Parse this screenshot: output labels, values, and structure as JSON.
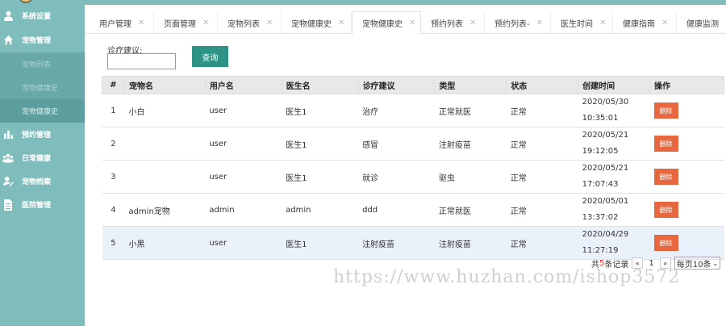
{
  "colors": {
    "sidebar": "#7fbcbc",
    "primary_button": "#2e9384",
    "delete_button": "#e7673e"
  },
  "sidebar": {
    "items": [
      {
        "label": "系统设置",
        "icon": "user-icon"
      },
      {
        "label": "宠物管理",
        "icon": "home-icon"
      },
      {
        "label": "预约管理",
        "icon": "bar-chart-icon"
      },
      {
        "label": "日常健康",
        "icon": "group-icon"
      },
      {
        "label": "宠物档案",
        "icon": "edit-icon"
      },
      {
        "label": "医院管理",
        "icon": "document-icon"
      }
    ],
    "sub_items": [
      {
        "label": "宠物列表"
      },
      {
        "label": "宠物健康史"
      },
      {
        "label": "宠物健康史"
      }
    ]
  },
  "tabs": [
    {
      "label": "用户管理"
    },
    {
      "label": "页面管理"
    },
    {
      "label": "宠物列表"
    },
    {
      "label": "宠物健康史"
    },
    {
      "label": "宠物健康史"
    },
    {
      "label": "预约列表"
    },
    {
      "label": "预约列表-"
    },
    {
      "label": "医生时间"
    },
    {
      "label": "健康指南"
    },
    {
      "label": "健康监测"
    }
  ],
  "search": {
    "label": "诊疗建议:",
    "value": "",
    "button": "查询"
  },
  "table": {
    "headers": [
      "#",
      "宠物名",
      "用户名",
      "医生名",
      "诊疗建议",
      "类型",
      "状态",
      "创建时间",
      "操作"
    ],
    "rows": [
      {
        "no": "1",
        "pet": "小白",
        "user": "user",
        "doctor": "医生1",
        "advice": "治疗",
        "type": "正常就医",
        "status": "正常",
        "date": "2020/05/30",
        "time": "10:35:01",
        "action": "删除"
      },
      {
        "no": "2",
        "pet": "",
        "user": "user",
        "doctor": "医生1",
        "advice": "感冒",
        "type": "注射疫苗",
        "status": "正常",
        "date": "2020/05/21",
        "time": "19:12:05",
        "action": "删除"
      },
      {
        "no": "3",
        "pet": "",
        "user": "user",
        "doctor": "医生1",
        "advice": "就诊",
        "type": "驱虫",
        "status": "正常",
        "date": "2020/05/21",
        "time": "17:07:43",
        "action": "删除"
      },
      {
        "no": "4",
        "pet": "admin宠物",
        "user": "admin",
        "doctor": "admin",
        "advice": "ddd",
        "type": "正常就医",
        "status": "正常",
        "date": "2020/05/01",
        "time": "13:37:02",
        "action": "删除"
      },
      {
        "no": "5",
        "pet": "小黑",
        "user": "user",
        "doctor": "医生1",
        "advice": "注射疫苗",
        "type": "注射疫苗",
        "status": "正常",
        "date": "2020/04/29",
        "time": "11:27:19",
        "action": "删除"
      }
    ]
  },
  "pager": {
    "prefix": "共",
    "count": "5",
    "suffix": "条记录",
    "prev": "«",
    "page": "1",
    "next": "»",
    "page_size": "每页10条"
  },
  "watermark": "https://www.huzhan.com/ishop3572"
}
